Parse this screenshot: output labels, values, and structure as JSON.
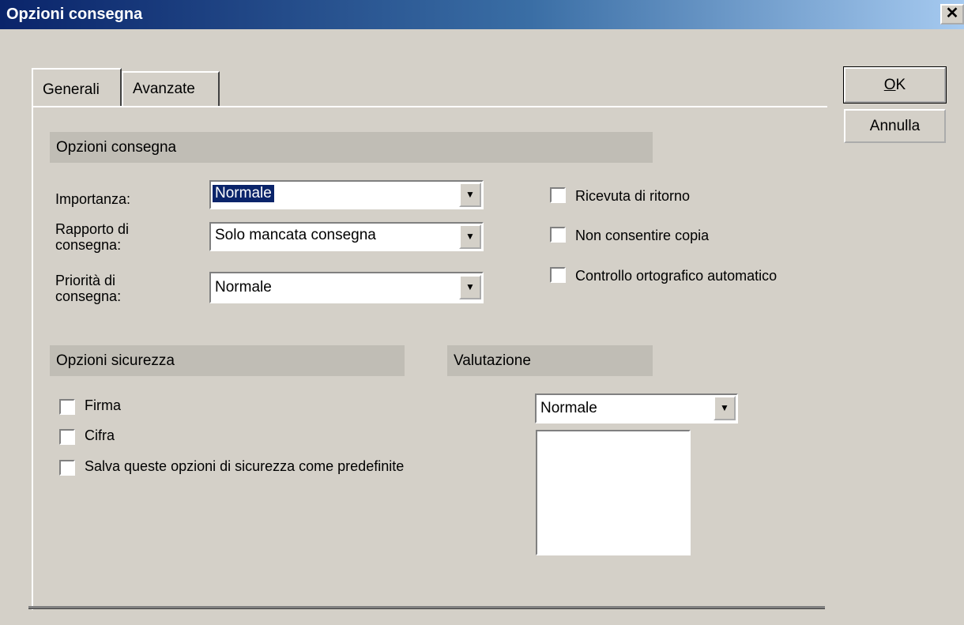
{
  "window": {
    "title": "Opzioni consegna",
    "close_symbol": "✕"
  },
  "tabs": [
    {
      "label": "Generali",
      "active": true
    },
    {
      "label": "Avanzate",
      "active": false
    }
  ],
  "buttons": {
    "ok": "OK",
    "cancel": "Annulla"
  },
  "delivery": {
    "header": "Opzioni consegna",
    "importance": {
      "label": "Importanza:",
      "value": "Normale"
    },
    "report": {
      "label_line1": "Rapporto di",
      "label_line2": "consegna:",
      "value": "Solo mancata consegna"
    },
    "priority": {
      "label_line1": "Priorità di",
      "label_line2": "consegna:",
      "value": "Normale"
    },
    "checkboxes": [
      {
        "label": "Ricevuta di ritorno",
        "checked": false
      },
      {
        "label": "Non consentire copia",
        "checked": false
      },
      {
        "label": "Controllo ortografico automatico",
        "checked": false
      }
    ]
  },
  "security": {
    "header": "Opzioni sicurezza",
    "checkboxes": [
      {
        "label": "Firma",
        "checked": false
      },
      {
        "label": "Cifra",
        "checked": false
      },
      {
        "label": "Salva queste opzioni di sicurezza come predefinite",
        "checked": false
      }
    ]
  },
  "rating": {
    "header": "Valutazione",
    "value": "Normale"
  },
  "icons": {
    "dropdown_arrow": "▼"
  }
}
